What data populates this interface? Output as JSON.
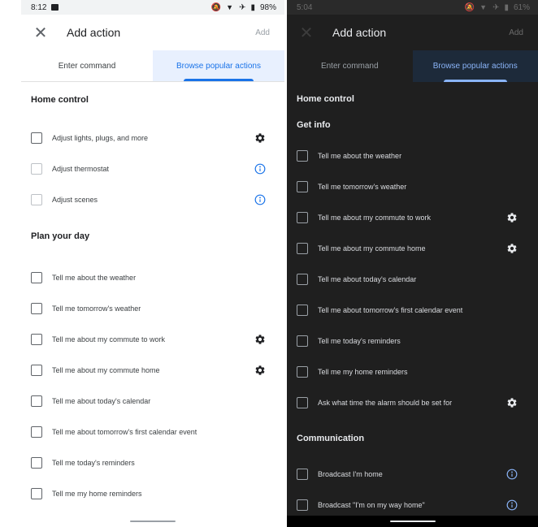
{
  "light": {
    "status": {
      "time": "8:12",
      "battery": "98%"
    },
    "appbar": {
      "title": "Add action",
      "add_label": "Add"
    },
    "tabs": {
      "enter": "Enter command",
      "browse": "Browse popular actions"
    },
    "sections": {
      "home_control": "Home control",
      "plan_your_day": "Plan your day"
    },
    "home_control_items": [
      {
        "label": "Adjust lights, plugs, and more",
        "trailing": "gear-icon"
      },
      {
        "label": "Adjust thermostat",
        "trailing": "info-icon"
      },
      {
        "label": "Adjust scenes",
        "trailing": "info-icon"
      }
    ],
    "plan_items": [
      {
        "label": "Tell me about the weather"
      },
      {
        "label": "Tell me tomorrow's weather"
      },
      {
        "label": "Tell me about my commute to work",
        "trailing": "gear-icon"
      },
      {
        "label": "Tell me about my commute home",
        "trailing": "gear-icon"
      },
      {
        "label": "Tell me about today's calendar"
      },
      {
        "label": "Tell me about tomorrow's first calendar event"
      },
      {
        "label": "Tell me today's reminders"
      },
      {
        "label": "Tell me my home reminders"
      }
    ]
  },
  "dark": {
    "status": {
      "time": "5:04",
      "battery": "61%"
    },
    "appbar": {
      "title": "Add action",
      "add_label": "Add"
    },
    "tabs": {
      "enter": "Enter command",
      "browse": "Browse popular actions"
    },
    "sections": {
      "home_control": "Home control",
      "get_info": "Get info",
      "communication": "Communication"
    },
    "get_info_items": [
      {
        "label": "Tell me about the weather"
      },
      {
        "label": "Tell me tomorrow's weather"
      },
      {
        "label": "Tell me about my commute to work",
        "trailing": "gear-icon"
      },
      {
        "label": "Tell me about my commute home",
        "trailing": "gear-icon"
      },
      {
        "label": "Tell me about today's calendar"
      },
      {
        "label": "Tell me about tomorrow's first calendar event"
      },
      {
        "label": "Tell me today's reminders"
      },
      {
        "label": "Tell me my home reminders"
      },
      {
        "label": "Ask what time the alarm should be set for",
        "trailing": "gear-icon"
      }
    ],
    "communication_items": [
      {
        "label": "Broadcast I'm home",
        "trailing": "info-icon"
      },
      {
        "label": "Broadcast \"I'm on my way home\"",
        "trailing": "info-icon"
      }
    ]
  },
  "colors": {
    "accent_light": "#1a73e8",
    "accent_dark": "#8ab4f8",
    "dark_bg": "#1f1f1f"
  }
}
